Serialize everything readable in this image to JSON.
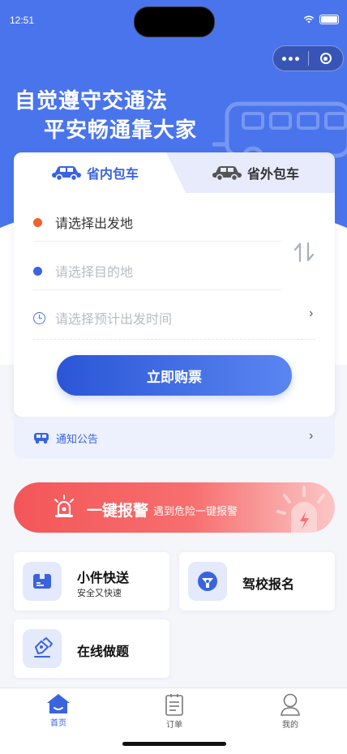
{
  "status_bar": {
    "time": "12:51"
  },
  "hero": {
    "slogan_line1": "自觉遵守交通法",
    "slogan_line2": "平安畅通靠大家"
  },
  "booking": {
    "tabs": [
      {
        "label": "省内包车",
        "active": true
      },
      {
        "label": "省外包车",
        "active": false
      }
    ],
    "departure_placeholder": "请选择出发地",
    "destination_placeholder": "请选择目的地",
    "time_placeholder": "请选择预计出发时间",
    "buy_label": "立即购票"
  },
  "notice": {
    "label": "通知公告"
  },
  "alarm": {
    "title": "一键报警",
    "subtitle": "遇到危险一键报警"
  },
  "services": [
    {
      "title": "小件快送",
      "subtitle": "安全又快速",
      "icon": "parcel-icon"
    },
    {
      "title": "驾校报名",
      "subtitle": "",
      "icon": "steering-wheel-icon"
    },
    {
      "title": "在线做题",
      "subtitle": "",
      "icon": "pen-exam-icon"
    }
  ],
  "tabbar": [
    {
      "label": "首页",
      "icon": "home-icon",
      "active": true
    },
    {
      "label": "订单",
      "icon": "order-icon",
      "active": false
    },
    {
      "label": "我的",
      "icon": "profile-icon",
      "active": false
    }
  ],
  "colors": {
    "primary": "#4a74ec",
    "accent_dot_departure": "#f06030",
    "accent_dot_destination": "#3a63e0",
    "alarm": "#f45658",
    "tabbar_active": "#3a63e0",
    "tabbar_inactive": "#666666"
  }
}
